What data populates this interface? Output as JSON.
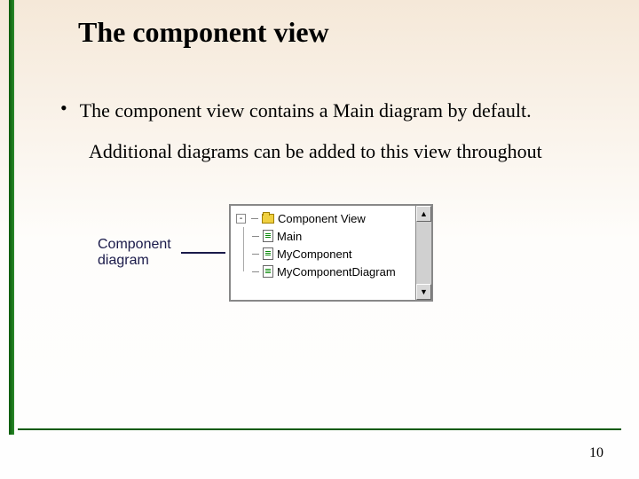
{
  "title": "The component view",
  "bullet": {
    "main": "The component view contains a Main diagram by default.",
    "sub": "Additional diagrams can be added to this view throughout"
  },
  "figure": {
    "caption_line1": "Component",
    "caption_line2": "diagram",
    "root_label": "Component View",
    "expander": "-",
    "children": [
      {
        "label": "Main"
      },
      {
        "label": "MyComponent"
      },
      {
        "label": "MyComponentDiagram"
      }
    ],
    "scroll_up": "▲",
    "scroll_down": "▼"
  },
  "page_number": "10"
}
